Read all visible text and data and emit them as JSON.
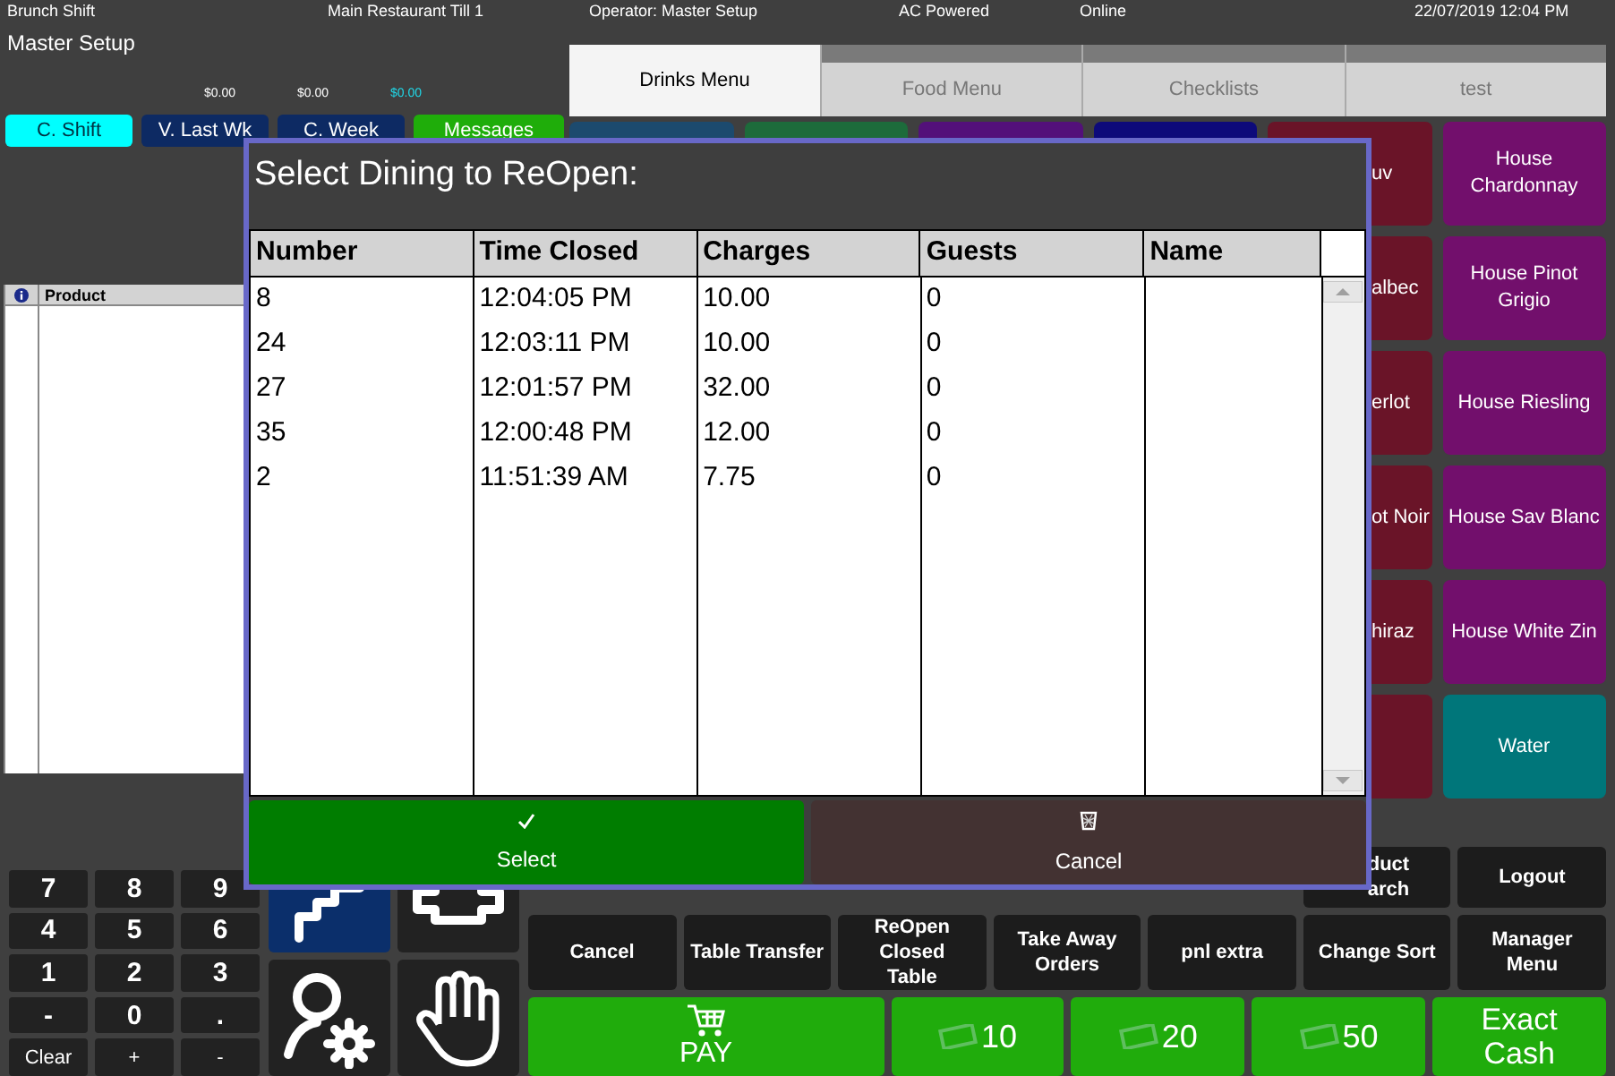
{
  "status_bar": {
    "shift": "Brunch Shift",
    "till": "Main Restaurant Till 1",
    "operator": "Operator: Master Setup",
    "power": "AC Powered",
    "network": "Online",
    "datetime": "22/07/2019 12:04 PM"
  },
  "user_label": "Master Setup",
  "totals": [
    {
      "value": "$0.00",
      "highlight": false
    },
    {
      "value": "$0.00",
      "highlight": false
    },
    {
      "value": "$0.00",
      "highlight": true
    }
  ],
  "period_buttons": [
    {
      "label": "C. Shift",
      "selected": true,
      "color": "#00ffff"
    },
    {
      "label": "V. Last Wk",
      "selected": false,
      "color": "#0d2a63"
    },
    {
      "label": "C. Week",
      "selected": false,
      "color": "#0d2a63"
    },
    {
      "label": "Messages",
      "selected": false,
      "color": "#1fad0a"
    }
  ],
  "order_list": {
    "columns": [
      "Product"
    ]
  },
  "menu_tabs": [
    {
      "label": "Drinks Menu",
      "selected": true
    },
    {
      "label": "Food Menu",
      "selected": false
    },
    {
      "label": "Checklists",
      "selected": false
    },
    {
      "label": "test",
      "selected": false
    }
  ],
  "menu_tiles": [
    [
      {
        "color": "#1c4a6e"
      },
      {
        "color": "#1d6b3b"
      },
      {
        "color": "#53107a"
      },
      {
        "color": "#0d0a7a"
      },
      {
        "label": "uv",
        "color": "#6a1428"
      },
      {
        "label": "House\nChardonnay",
        "color": "#720f6c"
      }
    ],
    [
      {
        "label": "albec",
        "color": "#6a1428"
      },
      {
        "label": "House Pinot\nGrigio",
        "color": "#720f6c"
      }
    ],
    [
      {
        "label": "erlot",
        "color": "#6a1428"
      },
      {
        "label": "House Riesling",
        "color": "#720f6c"
      }
    ],
    [
      {
        "label": "ot Noir",
        "color": "#6a1428"
      },
      {
        "label": "House Sav Blanc",
        "color": "#720f6c"
      }
    ],
    [
      {
        "label": "hiraz",
        "color": "#6a1428"
      },
      {
        "label": "House White Zin",
        "color": "#720f6c"
      }
    ],
    [
      {
        "color": "#6a1428"
      },
      {
        "label": "Water",
        "color": "#00767a"
      }
    ]
  ],
  "keypad": [
    "7",
    "8",
    "9",
    "4",
    "5",
    "6",
    "1",
    "2",
    "3",
    "-",
    "0",
    ".",
    "Clear",
    "+",
    "-"
  ],
  "function_rows": [
    [
      {
        "label": "duct\narch"
      },
      {
        "label": "Logout"
      }
    ],
    [
      {
        "label": "Cancel"
      },
      {
        "label": "Table Transfer"
      },
      {
        "label": "ReOpen\nClosed\nTable"
      },
      {
        "label": "Take Away\nOrders"
      },
      {
        "label": "pnl extra"
      },
      {
        "label": "Change Sort"
      },
      {
        "label": "Manager\nMenu"
      }
    ]
  ],
  "payment_buttons": [
    {
      "kind": "pay",
      "label": "PAY"
    },
    {
      "kind": "cash",
      "label": "10"
    },
    {
      "kind": "cash",
      "label": "20"
    },
    {
      "kind": "cash",
      "label": "50"
    },
    {
      "kind": "exact",
      "label": "Exact\nCash"
    }
  ],
  "dialog": {
    "title": "Select Dining to ReOpen:",
    "columns": [
      "Number",
      "Time Closed",
      "Charges",
      "Guests",
      "Name"
    ],
    "rows": [
      [
        "8",
        "12:04:05 PM",
        "10.00",
        "0"
      ],
      [
        "24",
        "12:03:11 PM",
        "10.00",
        "0"
      ],
      [
        "27",
        "12:01:57 PM",
        "32.00",
        "0"
      ],
      [
        "35",
        "12:00:48 PM",
        "12.00",
        "0"
      ],
      [
        "2",
        "11:51:39 AM",
        "7.75",
        "0"
      ]
    ],
    "buttons": [
      {
        "kind": "select",
        "label": "Select"
      },
      {
        "kind": "cancel",
        "label": "Cancel"
      }
    ]
  }
}
